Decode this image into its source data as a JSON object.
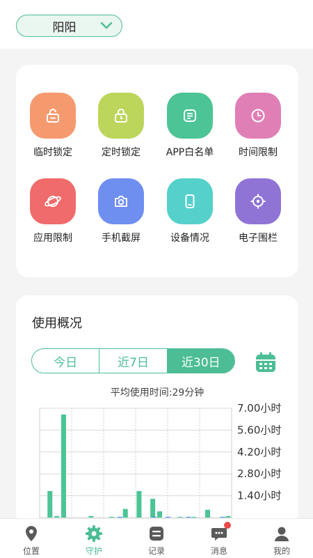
{
  "header": {
    "child_name": "阳阳"
  },
  "features": [
    {
      "label": "临时锁定",
      "icon": "unlock-icon",
      "color": "#f59a6f"
    },
    {
      "label": "定时锁定",
      "icon": "timed-lock-icon",
      "color": "#bcd65b"
    },
    {
      "label": "APP白名单",
      "icon": "whitelist-icon",
      "color": "#4cc496"
    },
    {
      "label": "时间限制",
      "icon": "clock-icon",
      "color": "#e07fb6"
    },
    {
      "label": "应用限制",
      "icon": "planet-icon",
      "color": "#f06b6b"
    },
    {
      "label": "手机截屏",
      "icon": "camera-icon",
      "color": "#6e8ef0"
    },
    {
      "label": "设备情况",
      "icon": "phone-icon",
      "color": "#55d0cb"
    },
    {
      "label": "电子围栏",
      "icon": "target-icon",
      "color": "#8f74d6"
    }
  ],
  "usage": {
    "title": "使用概况",
    "tabs": [
      "今日",
      "近7日",
      "近30日"
    ],
    "active_tab": 2,
    "average_text": "平均使用时间:29分钟"
  },
  "chart_data": {
    "type": "bar",
    "ylim": [
      0,
      7.0
    ],
    "y_ticks": [
      "7.00小时",
      "5.60小时",
      "4.20小时",
      "2.80小时",
      "1.40小时"
    ],
    "y_tick_values": [
      7.0,
      5.6,
      4.2,
      2.8,
      1.4
    ],
    "series": [
      {
        "values": [
          0,
          1.7,
          0.1,
          6.6,
          0,
          0,
          0,
          0.1,
          0,
          0,
          0.05,
          0,
          0.55,
          0,
          1.7,
          0,
          1.2,
          0.4,
          0,
          0,
          0.05,
          0,
          0.05,
          0,
          0.5,
          0,
          0,
          0.1
        ],
        "color": "#4cc496"
      },
      {
        "values": [
          0,
          0,
          0,
          0,
          0,
          0,
          0,
          0,
          0,
          0,
          0,
          0.05,
          0,
          0,
          0,
          0,
          0.05,
          0,
          0.05,
          0,
          0,
          0.05,
          0,
          0,
          0,
          0,
          0.05,
          0
        ],
        "color": "#3a8ee0"
      }
    ]
  },
  "nav": {
    "items": [
      {
        "label": "位置",
        "icon": "location-icon",
        "active": false
      },
      {
        "label": "守护",
        "icon": "gear-icon",
        "active": true
      },
      {
        "label": "记录",
        "icon": "record-icon",
        "active": false
      },
      {
        "label": "消息",
        "icon": "message-icon",
        "active": false
      },
      {
        "label": "我的",
        "icon": "user-icon",
        "active": false
      }
    ],
    "colors": {
      "active": "#4cbd94",
      "inactive": "#5a5a5a"
    }
  }
}
